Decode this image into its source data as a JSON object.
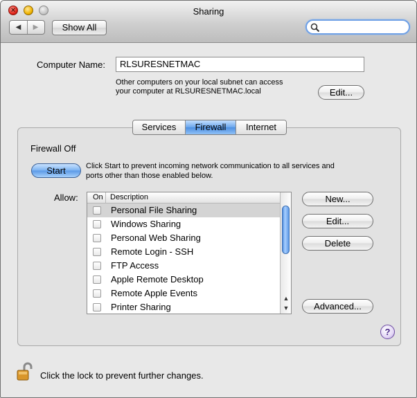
{
  "window": {
    "title": "Sharing"
  },
  "toolbar": {
    "back_icon": "back-arrow-icon",
    "forward_icon": "forward-arrow-icon",
    "show_all": "Show All",
    "search_placeholder": ""
  },
  "computer": {
    "name_label": "Computer Name:",
    "name_value": "RLSURESNETMAC",
    "info_line1": "Other computers on your local subnet can access",
    "info_line2": "your computer at RLSURESNETMAC.local",
    "edit_button": "Edit..."
  },
  "tabs": [
    {
      "label": "Services",
      "active": false
    },
    {
      "label": "Firewall",
      "active": true
    },
    {
      "label": "Internet",
      "active": false
    }
  ],
  "firewall": {
    "status": "Firewall Off",
    "start_button": "Start",
    "description_line1": "Click Start to prevent incoming network communication to all services and",
    "description_line2": "ports other than those enabled below.",
    "allow_label": "Allow:",
    "columns": {
      "on": "On",
      "description": "Description"
    },
    "services": [
      {
        "name": "Personal File Sharing",
        "on": false,
        "selected": true
      },
      {
        "name": "Windows Sharing",
        "on": false,
        "selected": false
      },
      {
        "name": "Personal Web Sharing",
        "on": false,
        "selected": false
      },
      {
        "name": "Remote Login - SSH",
        "on": false,
        "selected": false
      },
      {
        "name": "FTP Access",
        "on": false,
        "selected": false
      },
      {
        "name": "Apple Remote Desktop",
        "on": false,
        "selected": false
      },
      {
        "name": "Remote Apple Events",
        "on": false,
        "selected": false
      },
      {
        "name": "Printer Sharing",
        "on": false,
        "selected": false
      }
    ],
    "buttons": {
      "new": "New...",
      "edit": "Edit...",
      "delete": "Delete",
      "advanced": "Advanced..."
    },
    "help": "?"
  },
  "footer": {
    "lock_text": "Click the lock to prevent further changes."
  },
  "colors": {
    "accent_blue": "#5a98e6",
    "selection_gray": "#d4d4d4"
  }
}
